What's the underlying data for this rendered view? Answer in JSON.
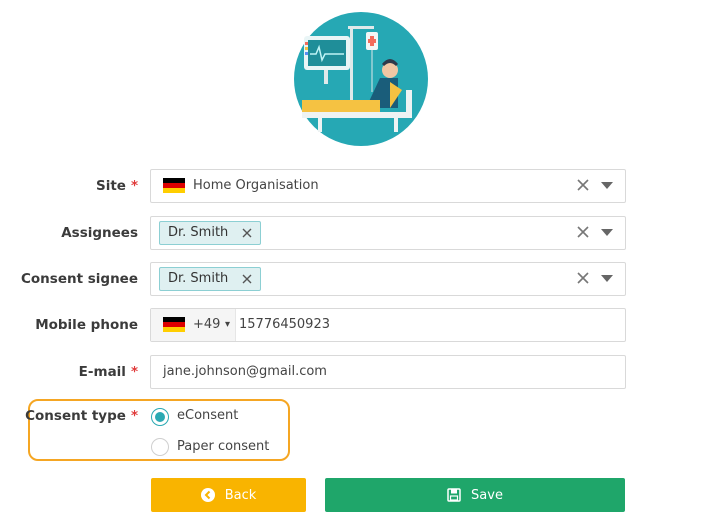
{
  "form": {
    "site": {
      "label": "Site",
      "required_mark": "*",
      "value": "Home Organisation",
      "flag": "germany-flag-icon"
    },
    "assignees": {
      "label": "Assignees",
      "tag": "Dr. Smith"
    },
    "consent_signee": {
      "label": "Consent signee",
      "tag": "Dr. Smith"
    },
    "mobile_phone": {
      "label": "Mobile phone",
      "country_code": "+49",
      "caret": "▾",
      "number": "15776450923"
    },
    "email": {
      "label": "E-mail",
      "required_mark": "*",
      "value": "jane.johnson@gmail.com"
    },
    "consent_type": {
      "label": "Consent type",
      "required_mark": "*",
      "options": [
        {
          "label": "eConsent",
          "selected": true
        },
        {
          "label": "Paper consent",
          "selected": false
        }
      ]
    }
  },
  "buttons": {
    "back_label": "Back",
    "save_label": "Save"
  },
  "colors": {
    "accent": "#2aa9b3",
    "back_button": "#f9b400",
    "save_button": "#1fa66a",
    "highlight_border": "#f5a623",
    "required": "#e03b3b",
    "tag_bg": "#dff0f1"
  }
}
